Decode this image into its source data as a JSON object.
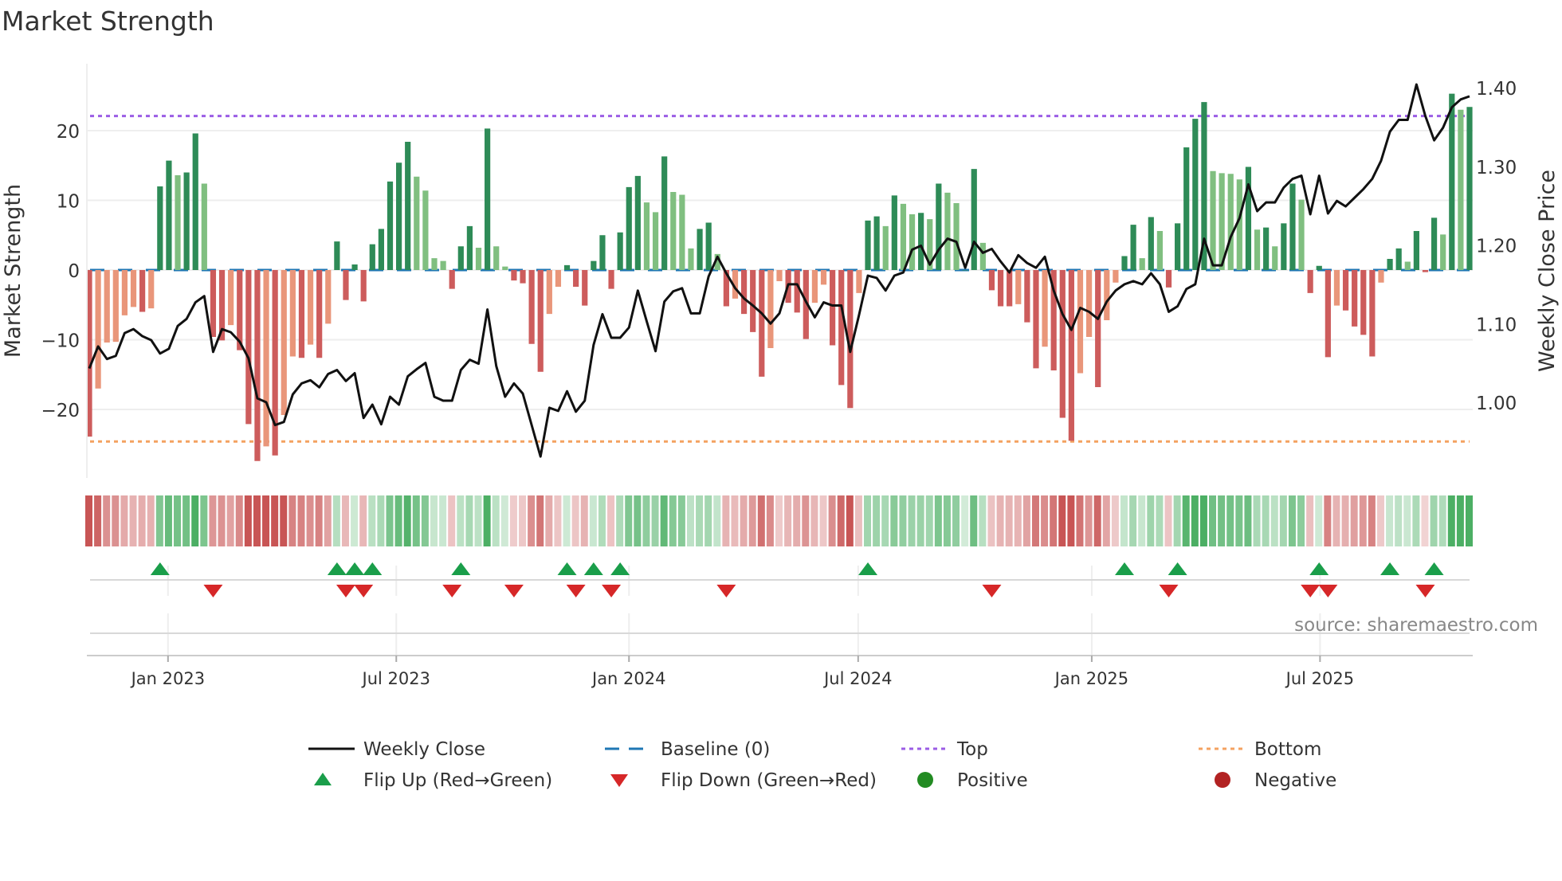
{
  "chart_data": {
    "type": "bar",
    "title": "Market Strength",
    "ylabel": "Market Strength",
    "y2label": "Weekly Close Price",
    "ylim": [
      -28,
      29
    ],
    "y2lim": [
      0.921,
      1.451
    ],
    "yticks": [
      20,
      10,
      0,
      -10,
      -20
    ],
    "ytick_labels": [
      "20",
      "10",
      "0",
      "−10",
      "−20"
    ],
    "y2ticks": [
      1.4,
      1.3,
      1.2,
      1.1,
      1.0
    ],
    "y2tick_labels": [
      "1.40",
      "1.30",
      "1.20",
      "1.10",
      "1.00"
    ],
    "xticks": [
      {
        "week_index": 8.9,
        "label": "Jan 2023"
      },
      {
        "week_index": 34.7,
        "label": "Jul 2023"
      },
      {
        "week_index": 61.0,
        "label": "Jan 2024"
      },
      {
        "week_index": 86.9,
        "label": "Jul 2024"
      },
      {
        "week_index": 113.3,
        "label": "Jan 2025"
      },
      {
        "week_index": 139.1,
        "label": "Jul 2025"
      }
    ],
    "top_level": 22.1,
    "bottom_level": -24.6,
    "baseline": 0,
    "grid": true,
    "legend_position": "bottom-center",
    "series": [
      {
        "name": "Market Strength",
        "values": [
          -23.9,
          -17.0,
          -10.4,
          -10.3,
          -6.5,
          -5.3,
          -6.0,
          -5.5,
          12.0,
          15.7,
          13.6,
          14.0,
          19.6,
          12.4,
          -9.6,
          -10.1,
          -7.9,
          -11.5,
          -22.1,
          -27.4,
          -25.3,
          -26.6,
          -20.8,
          -12.4,
          -12.6,
          -10.7,
          -12.6,
          -7.7,
          4.1,
          -4.3,
          0.8,
          -4.5,
          3.7,
          5.9,
          12.7,
          15.4,
          18.4,
          13.4,
          11.4,
          1.7,
          1.3,
          -2.7,
          3.4,
          6.3,
          3.2,
          20.3,
          3.4,
          0.5,
          -1.5,
          -1.9,
          -10.6,
          -14.6,
          -6.3,
          -2.4,
          0.7,
          -2.4,
          -5.1,
          1.3,
          5.0,
          -2.7,
          5.4,
          11.9,
          13.5,
          9.7,
          8.3,
          16.3,
          11.2,
          10.8,
          3.1,
          5.9,
          6.8,
          2.3,
          -5.2,
          -4.1,
          -6.3,
          -8.9,
          -15.3,
          -11.2,
          -1.6,
          -4.7,
          -6.1,
          -9.9,
          -4.7,
          -2.1,
          -10.8,
          -16.5,
          -19.8,
          -3.3,
          7.1,
          7.7,
          6.3,
          10.7,
          9.5,
          8.0,
          8.2,
          7.3,
          12.4,
          11.1,
          9.6,
          0.0,
          14.5,
          3.9,
          -2.9,
          -5.2,
          -5.2,
          -4.9,
          -7.5,
          -14.1,
          -11.0,
          -14.4,
          -21.2,
          -24.5,
          -14.8,
          -9.6,
          -16.8,
          -7.2,
          -1.8,
          2.0,
          6.5,
          1.7,
          7.6,
          5.6,
          -2.5,
          6.7,
          17.6,
          21.7,
          24.1,
          14.2,
          13.9,
          13.8,
          13.0,
          14.8,
          5.8,
          6.1,
          3.4,
          6.7,
          12.4,
          10.1,
          -3.3,
          0.6,
          -12.5,
          -5.1,
          -5.8,
          -8.1,
          -9.3,
          -12.4,
          -1.8,
          1.6,
          3.1,
          1.2,
          5.6,
          -0.3,
          7.5,
          5.1,
          25.3,
          23.0,
          23.4
        ]
      },
      {
        "name": "Weekly Close",
        "axis": "right",
        "values": [
          1.043,
          1.071,
          1.055,
          1.059,
          1.088,
          1.093,
          1.084,
          1.079,
          1.062,
          1.068,
          1.097,
          1.106,
          1.127,
          1.135,
          1.064,
          1.093,
          1.089,
          1.077,
          1.056,
          1.005,
          1.0,
          0.971,
          0.975,
          1.01,
          1.024,
          1.028,
          1.019,
          1.036,
          1.041,
          1.027,
          1.037,
          0.98,
          0.997,
          0.972,
          1.007,
          0.997,
          1.033,
          1.042,
          1.05,
          1.007,
          1.002,
          1.002,
          1.041,
          1.054,
          1.049,
          1.118,
          1.046,
          1.007,
          1.024,
          1.011,
          0.971,
          0.931,
          0.993,
          0.989,
          1.014,
          0.988,
          1.002,
          1.073,
          1.112,
          1.082,
          1.082,
          1.095,
          1.142,
          1.103,
          1.065,
          1.128,
          1.141,
          1.145,
          1.113,
          1.113,
          1.16,
          1.185,
          1.164,
          1.145,
          1.132,
          1.123,
          1.113,
          1.1,
          1.113,
          1.15,
          1.15,
          1.128,
          1.108,
          1.127,
          1.123,
          1.123,
          1.064,
          1.111,
          1.161,
          1.158,
          1.142,
          1.161,
          1.165,
          1.194,
          1.199,
          1.175,
          1.194,
          1.208,
          1.204,
          1.171,
          1.204,
          1.19,
          1.195,
          1.179,
          1.165,
          1.187,
          1.177,
          1.171,
          1.185,
          1.142,
          1.112,
          1.092,
          1.12,
          1.115,
          1.106,
          1.128,
          1.142,
          1.15,
          1.154,
          1.15,
          1.164,
          1.15,
          1.115,
          1.122,
          1.144,
          1.15,
          1.208,
          1.174,
          1.174,
          1.21,
          1.234,
          1.277,
          1.243,
          1.254,
          1.254,
          1.273,
          1.284,
          1.288,
          1.239,
          1.288,
          1.24,
          1.256,
          1.249,
          1.26,
          1.271,
          1.284,
          1.307,
          1.344,
          1.359,
          1.359,
          1.404,
          1.364,
          1.333,
          1.349,
          1.375,
          1.385,
          1.389
        ]
      }
    ],
    "flip_up_weeks": [
      8,
      28,
      30,
      32,
      42,
      54,
      57,
      60,
      88,
      117,
      123,
      139,
      147,
      152
    ],
    "flip_down_weeks": [
      14,
      29,
      31,
      41,
      48,
      55,
      59,
      72,
      102,
      122,
      138,
      140,
      151
    ]
  },
  "legend": {
    "weekly_close": "Weekly Close",
    "baseline": "Baseline (0)",
    "top": "Top",
    "bottom": "Bottom",
    "flip_up": "Flip Up (Red→Green)",
    "flip_down": "Flip Down (Green→Red)",
    "positive": "Positive",
    "negative": "Negative"
  },
  "source": "source: sharemaestro.com",
  "colors": {
    "pos_strong": "#2e8b57",
    "pos_weak": "#80bf80",
    "neg_strong": "#cd5c5c",
    "neg_weak": "#e9967a",
    "price": "#111111",
    "baseline": "#1f77b4",
    "top": "#9b5de5",
    "bottom": "#f4a261",
    "flip_up": "#1a9e4a",
    "flip_down": "#d62728",
    "positive_dot": "#228b22",
    "negative_dot": "#b22222"
  }
}
